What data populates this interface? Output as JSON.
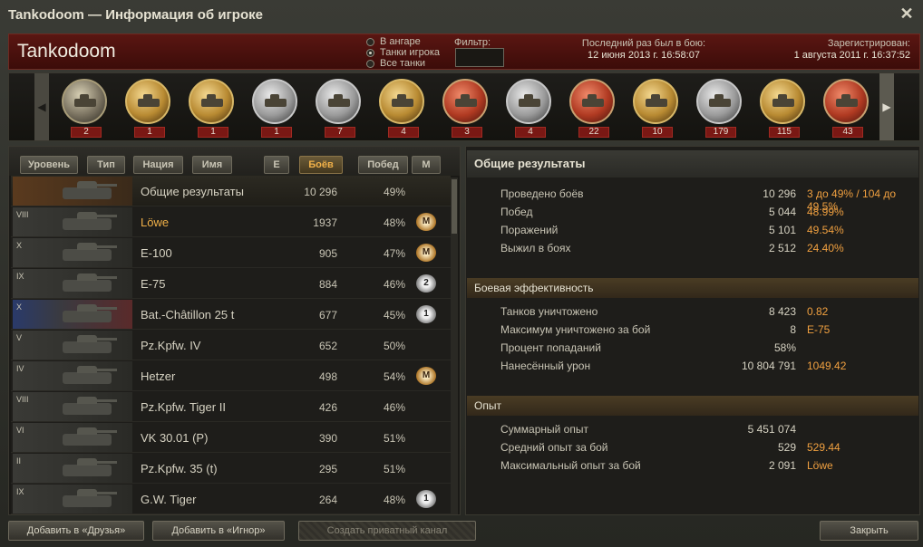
{
  "window": {
    "title": "Tankodoom — Информация об игроке",
    "close_label": "✕"
  },
  "header": {
    "player_name": "Tankodoom",
    "radio_options": [
      "В ангаре",
      "Танки игрока",
      "Все танки"
    ],
    "radio_selected": "Танки игрока",
    "filter_label": "Фильтр:",
    "filter_value": "",
    "last_battle_label": "Последний раз был в бою:",
    "last_battle_value": "12 июня 2013 г. 16:58:07",
    "registered_label": "Зарегистрирован:",
    "registered_value": "1 августа 2011 г. 16:37:52"
  },
  "medals": [
    {
      "icon": "medal-1-icon",
      "count": "2",
      "style": "plain"
    },
    {
      "icon": "medal-2-icon",
      "count": "1",
      "style": "gold"
    },
    {
      "icon": "medal-3-icon",
      "count": "1",
      "style": "gold"
    },
    {
      "icon": "medal-4-icon",
      "count": "1",
      "style": "silver"
    },
    {
      "icon": "medal-5-icon",
      "count": "7",
      "style": "silver"
    },
    {
      "icon": "medal-6-icon",
      "count": "4",
      "style": "gold"
    },
    {
      "icon": "medal-7-icon",
      "count": "3",
      "style": "red"
    },
    {
      "icon": "medal-8-icon",
      "count": "4",
      "style": "silver"
    },
    {
      "icon": "medal-9-icon",
      "count": "22",
      "style": "red"
    },
    {
      "icon": "medal-10-icon",
      "count": "10",
      "style": "gold"
    },
    {
      "icon": "medal-11-icon",
      "count": "179",
      "style": "silver"
    },
    {
      "icon": "medal-12-icon",
      "count": "115",
      "style": "gold"
    },
    {
      "icon": "medal-13-icon",
      "count": "43",
      "style": "red"
    }
  ],
  "sort_buttons": {
    "level": "Уровень",
    "type": "Тип",
    "nation": "Нация",
    "name": "Имя",
    "e": "E",
    "battles": "Боёв",
    "wins": "Побед",
    "m": "M"
  },
  "rows": [
    {
      "tier": "",
      "name": "Общие результаты",
      "battles": "10 296",
      "winrate": "49%",
      "mastery": "",
      "gold": false,
      "summary": true
    },
    {
      "tier": "VIII",
      "name": "Löwe",
      "battles": "1937",
      "winrate": "48%",
      "mastery": "M",
      "gold": true
    },
    {
      "tier": "X",
      "name": "E-100",
      "battles": "905",
      "winrate": "47%",
      "mastery": "M",
      "gold": false
    },
    {
      "tier": "IX",
      "name": "E-75",
      "battles": "884",
      "winrate": "46%",
      "mastery": "2",
      "gold": false
    },
    {
      "tier": "X",
      "name": "Bat.-Châtillon 25 t",
      "battles": "677",
      "winrate": "45%",
      "mastery": "1",
      "gold": false
    },
    {
      "tier": "V",
      "name": "Pz.Kpfw. IV",
      "battles": "652",
      "winrate": "50%",
      "mastery": "",
      "gold": false
    },
    {
      "tier": "IV",
      "name": "Hetzer",
      "battles": "498",
      "winrate": "54%",
      "mastery": "M",
      "gold": false
    },
    {
      "tier": "VIII",
      "name": "Pz.Kpfw. Tiger II",
      "battles": "426",
      "winrate": "46%",
      "mastery": "",
      "gold": false
    },
    {
      "tier": "VI",
      "name": "VK 30.01 (P)",
      "battles": "390",
      "winrate": "51%",
      "mastery": "",
      "gold": false
    },
    {
      "tier": "II",
      "name": "Pz.Kpfw. 35 (t)",
      "battles": "295",
      "winrate": "51%",
      "mastery": "",
      "gold": false
    },
    {
      "tier": "IX",
      "name": "G.W. Tiger",
      "battles": "264",
      "winrate": "48%",
      "mastery": "1",
      "gold": false
    }
  ],
  "stats": {
    "general_title": "Общие результаты",
    "general": [
      {
        "label": "Проведено боёв",
        "value": "10 296",
        "extra": "3 до 49% / 104 до 49.5%"
      },
      {
        "label": "Побед",
        "value": "5 044",
        "extra": "48.99%"
      },
      {
        "label": "Поражений",
        "value": "5 101",
        "extra": "49.54%"
      },
      {
        "label": "Выжил в боях",
        "value": "2 512",
        "extra": "24.40%"
      }
    ],
    "combat_title": "Боевая эффективность",
    "combat": [
      {
        "label": "Танков уничтожено",
        "value": "8 423",
        "extra": "0.82"
      },
      {
        "label": "Максимум уничтожено за бой",
        "value": "8",
        "extra": "E-75"
      },
      {
        "label": "Процент попаданий",
        "value": "58%",
        "extra": ""
      },
      {
        "label": "Нанесённый урон",
        "value": "10 804 791",
        "extra": "1049.42"
      }
    ],
    "xp_title": "Опыт",
    "xp": [
      {
        "label": "Суммарный опыт",
        "value": "5 451 074",
        "extra": ""
      },
      {
        "label": "Средний опыт за бой",
        "value": "529",
        "extra": "529.44"
      },
      {
        "label": "Максимальный опыт за бой",
        "value": "2 091",
        "extra": "Löwe"
      }
    ]
  },
  "buttons": {
    "add_friend": "Добавить в «Друзья»",
    "add_ignore": "Добавить в «Игнор»",
    "private_channel": "Создать приватный канал",
    "close": "Закрыть"
  }
}
